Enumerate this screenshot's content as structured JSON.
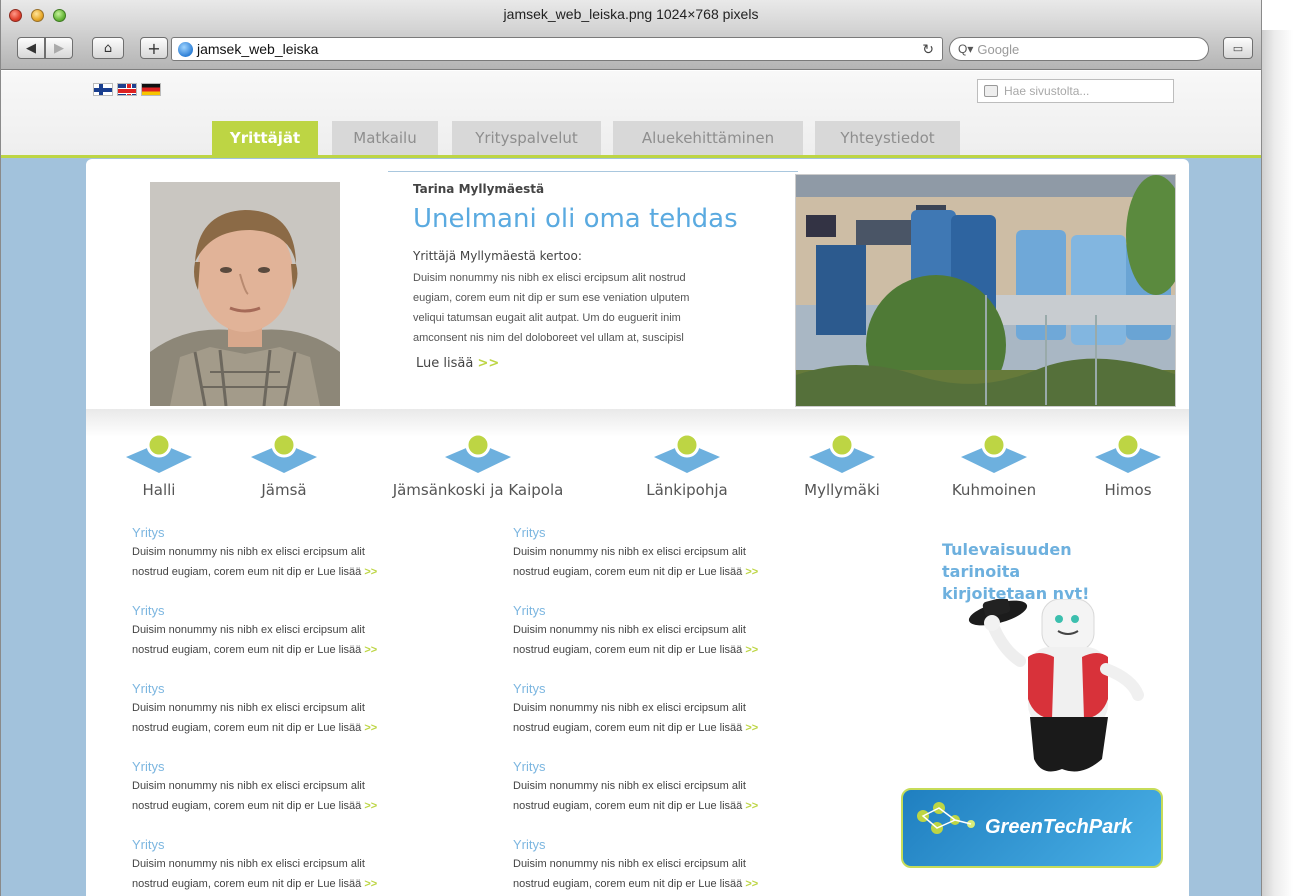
{
  "window": {
    "title": "jamsek_web_leiska.png 1024×768 pixels",
    "url": "jamsek_web_leiska",
    "search_placeholder": "Google"
  },
  "site": {
    "search_placeholder": "Hae sivustolta...",
    "flags": [
      "fi",
      "uk",
      "de"
    ],
    "tabs": [
      {
        "label": "Yrittäjät",
        "active": true
      },
      {
        "label": "Matkailu",
        "active": false
      },
      {
        "label": "Yrityspalvelut",
        "active": false
      },
      {
        "label": "Aluekehittäminen",
        "active": false
      },
      {
        "label": "Yhteystiedot",
        "active": false
      }
    ]
  },
  "story": {
    "author": "Tarina Myllymäestä",
    "title": "Unelmani oli oma tehdas",
    "lead": "Yrittäjä Myllymäestä kertoo:",
    "body_lines": [
      "Duisim nonummy nis nibh ex elisci ercipsum alit nostrud",
      "eugiam, corem eum nit dip er sum ese veniation ulputem",
      "veliqui tatumsan eugait alit autpat. Um do euguerit inim",
      "amconsent nis nim del doloboreet vel ullam at, suscipisl"
    ],
    "more_label": "Lue lisää",
    "more_arrow": ">>"
  },
  "places": [
    "Halli",
    "Jämsä",
    "Jämsänkoski ja Kaipola",
    "Länkipohja",
    "Myllymäki",
    "Kuhmoinen",
    "Himos"
  ],
  "news": {
    "title": "Yritys",
    "line1": "Duisim nonummy nis nibh ex elisci ercipsum alit",
    "line2": "nostrud eugiam, corem eum nit dip er Lue lisää",
    "arrow": ">>"
  },
  "sidebar": {
    "title_line1": "Tulevaisuuden tarinoita",
    "title_line2": "kirjoitetaan nyt!",
    "banner_name": "GreenTechPark"
  },
  "colors": {
    "accent_green": "#bdd544",
    "accent_blue": "#5aaae0",
    "page_bg": "#a2c2dc"
  }
}
